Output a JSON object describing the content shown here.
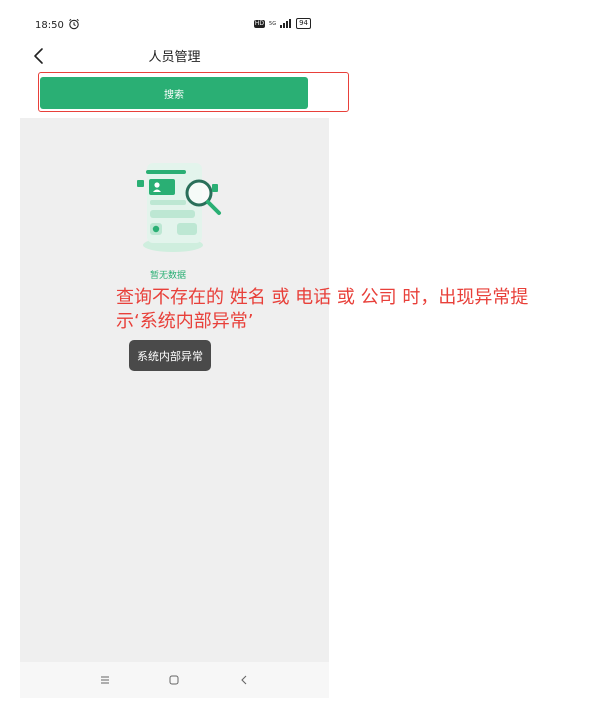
{
  "status_bar": {
    "time": "18:50",
    "network": "HD",
    "signal_label": "5G",
    "battery": "94"
  },
  "header": {
    "title": "人员管理"
  },
  "search": {
    "button_label": "搜索"
  },
  "empty_state": {
    "text": "暂无数据"
  },
  "annotation": {
    "text": "查询不存在的 姓名 或 电话 或 公司 时，出现异常提示‘系统内部异常’",
    "color": "#e8403a"
  },
  "toast": {
    "text": "系统内部异常"
  },
  "colors": {
    "accent": "#2aaf74",
    "highlight": "#e8403a"
  },
  "icons": [
    "alarm-icon",
    "signal-icon",
    "battery-icon",
    "back-icon",
    "empty-search-illustration",
    "menu-icon",
    "home-icon",
    "nav-back-icon"
  ]
}
